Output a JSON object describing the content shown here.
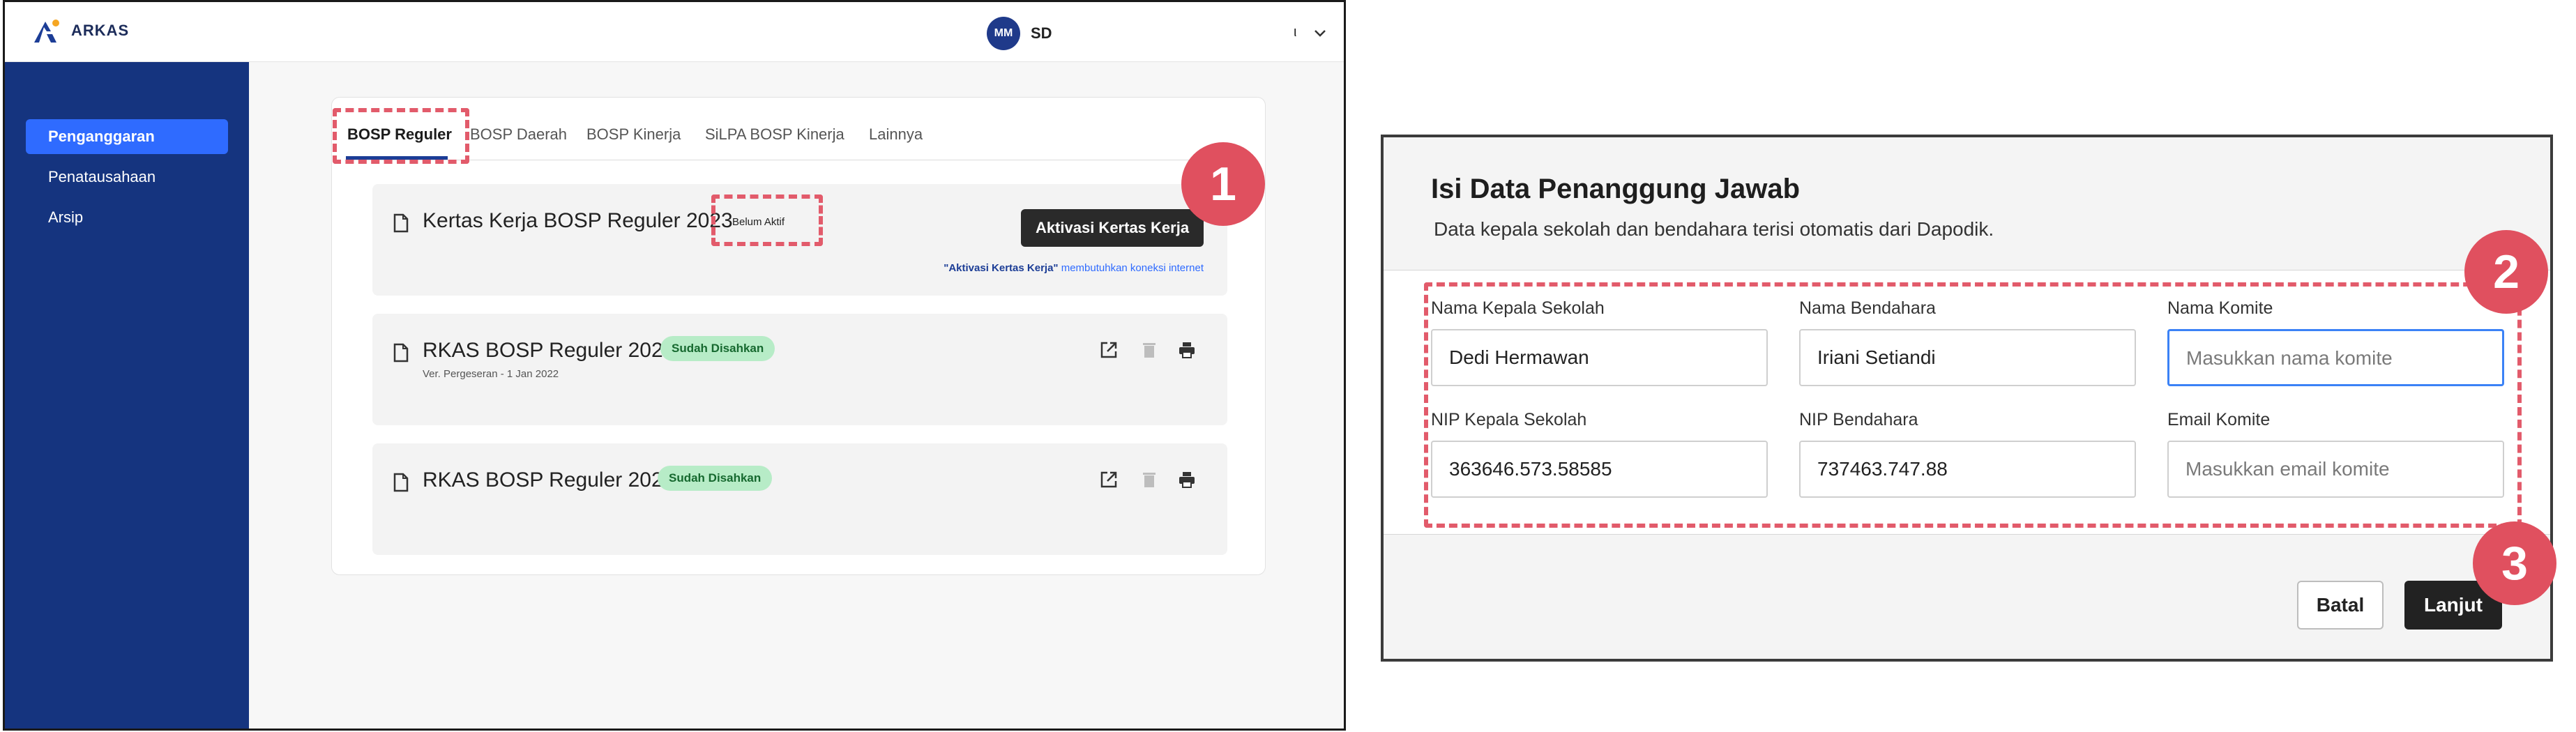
{
  "app": {
    "brand": "ARKAS",
    "user_initials": "MM",
    "user_name": "SD",
    "top_right_char": "ι",
    "sidebar": {
      "items": [
        {
          "label": "Penganggaran",
          "active": true
        },
        {
          "label": "Penatausahaan",
          "active": false
        },
        {
          "label": "Arsip",
          "active": false
        }
      ]
    },
    "tabs": [
      {
        "label": "BOSP Reguler",
        "active": true
      },
      {
        "label": "BOSP Daerah"
      },
      {
        "label": "BOSP Kinerja"
      },
      {
        "label": "SiLPA BOSP Kinerja"
      },
      {
        "label": "Lainnya"
      }
    ],
    "panels": [
      {
        "title": "Kertas Kerja BOSP Reguler 2023",
        "badge": "Belum Aktif",
        "button": "Aktivasi Kertas Kerja",
        "note_bold": "\"Aktivasi Kertas Kerja\"",
        "note_rest": " membutuhkan koneksi internet"
      },
      {
        "title": "RKAS BOSP Reguler 2022",
        "badge": "Sudah Disahkan",
        "subtitle": "Ver. Pergeseran - 1 Jan 2022"
      },
      {
        "title": "RKAS BOSP Reguler 2021",
        "badge": "Sudah Disahkan"
      }
    ],
    "icons": [
      "doc-icon",
      "open-external-icon",
      "trash-icon",
      "print-icon",
      "chevron-down-icon"
    ]
  },
  "callouts": [
    "1",
    "2",
    "3"
  ],
  "dialog": {
    "title": "Isi Data Penanggung Jawab",
    "subtitle": "Data kepala sekolah dan bendahara terisi otomatis dari Dapodik.",
    "fields": [
      {
        "label": "Nama Kepala Sekolah",
        "value": "Dedi Hermawan",
        "placeholder": ""
      },
      {
        "label": "Nama Bendahara",
        "value": "Iriani Setiandi",
        "placeholder": ""
      },
      {
        "label": "Nama Komite",
        "value": "",
        "placeholder": "Masukkan nama komite"
      },
      {
        "label": "NIP Kepala Sekolah",
        "value": "363646.573.58585",
        "placeholder": ""
      },
      {
        "label": "NIP Bendahara",
        "value": "737463.747.88",
        "placeholder": ""
      },
      {
        "label": "Email Komite",
        "value": "",
        "placeholder": "Masukkan email komite"
      }
    ],
    "cancel_label": "Batal",
    "next_label": "Lanjut"
  },
  "colors": {
    "sidebar": "#15347f",
    "sidebar_active": "#2f6bff",
    "callout": "#e0505f",
    "dash": "#e25b6b",
    "badge_green": "#b7ecc7"
  }
}
